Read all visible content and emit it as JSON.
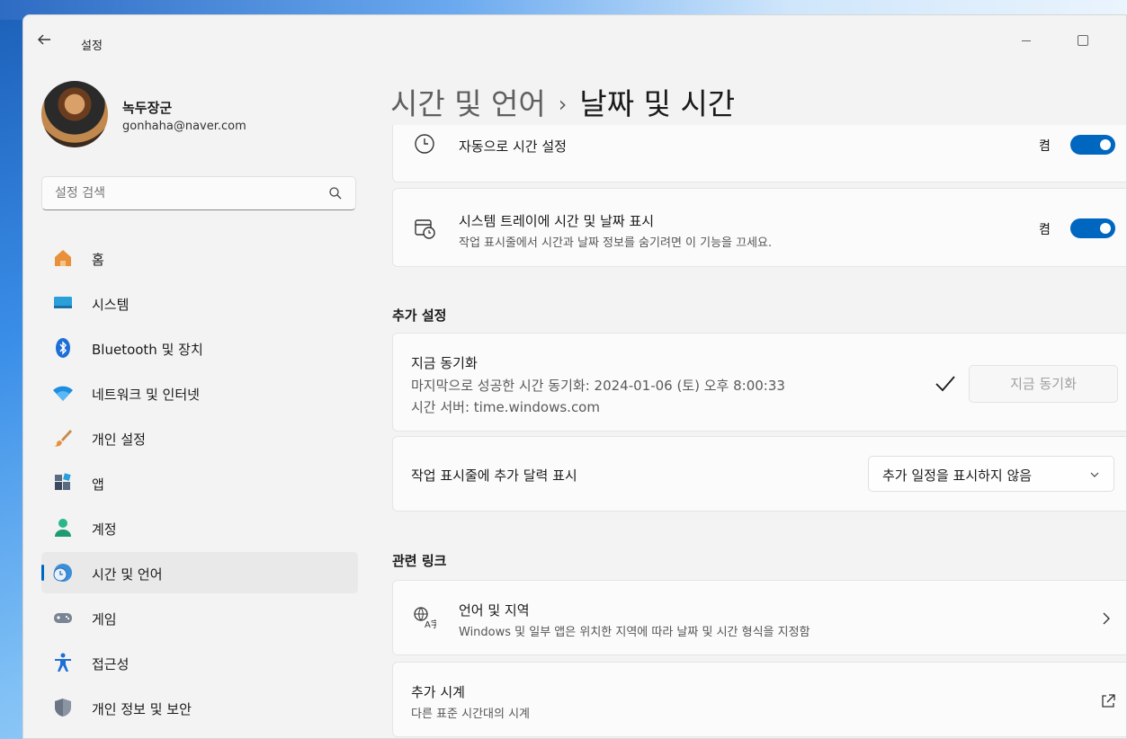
{
  "window": {
    "app_title": "설정"
  },
  "profile": {
    "name": "녹두장군",
    "email": "gonhaha@naver.com"
  },
  "search": {
    "placeholder": "설정 검색"
  },
  "nav": {
    "items": [
      {
        "label": "홈",
        "icon": "home-icon"
      },
      {
        "label": "시스템",
        "icon": "system-icon"
      },
      {
        "label": "Bluetooth 및 장치",
        "icon": "bluetooth-icon"
      },
      {
        "label": "네트워크 및 인터넷",
        "icon": "wifi-icon"
      },
      {
        "label": "개인 설정",
        "icon": "paintbrush-icon"
      },
      {
        "label": "앱",
        "icon": "apps-icon"
      },
      {
        "label": "계정",
        "icon": "account-icon"
      },
      {
        "label": "시간 및 언어",
        "icon": "time-language-icon",
        "active": true
      },
      {
        "label": "게임",
        "icon": "gamepad-icon"
      },
      {
        "label": "접근성",
        "icon": "accessibility-icon"
      },
      {
        "label": "개인 정보 및 보안",
        "icon": "shield-icon"
      }
    ]
  },
  "header": {
    "crumb": "시간 및 언어",
    "separator": "›",
    "title": "날짜 및 시간"
  },
  "settings": {
    "auto_time": {
      "title": "자동으로 시간 설정",
      "state": "켬",
      "icon": "clock-icon"
    },
    "tray": {
      "title": "시스템 트레이에 시간 및 날짜 표시",
      "desc": "작업 표시줄에서 시간과 날짜 정보를 숨기려면 이 기능을 끄세요.",
      "state": "켬",
      "icon": "calendar-clock-icon"
    }
  },
  "additional": {
    "heading": "추가 설정",
    "sync": {
      "title": "지금 동기화",
      "last": "마지막으로 성공한 시간 동기화: 2024-01-06 (토) 오후 8:00:33",
      "server": "시간 서버: time.windows.com",
      "button": "지금 동기화"
    },
    "calendar": {
      "title": "작업 표시줄에 추가 달력 표시",
      "selected": "추가 일정을 표시하지 않음"
    }
  },
  "related": {
    "heading": "관련 링크",
    "language": {
      "title": "언어 및 지역",
      "desc": "Windows 및 일부 앱은 위치한 지역에 따라 날짜 및 시간 형식을 지정함",
      "icon": "language-region-icon"
    },
    "clocks": {
      "title": "추가 시계",
      "desc": "다른 표준 시간대의 시계"
    }
  },
  "colors": {
    "accent": "#0067c0",
    "background": "#f3f3f3",
    "card": "#fbfbfb"
  }
}
